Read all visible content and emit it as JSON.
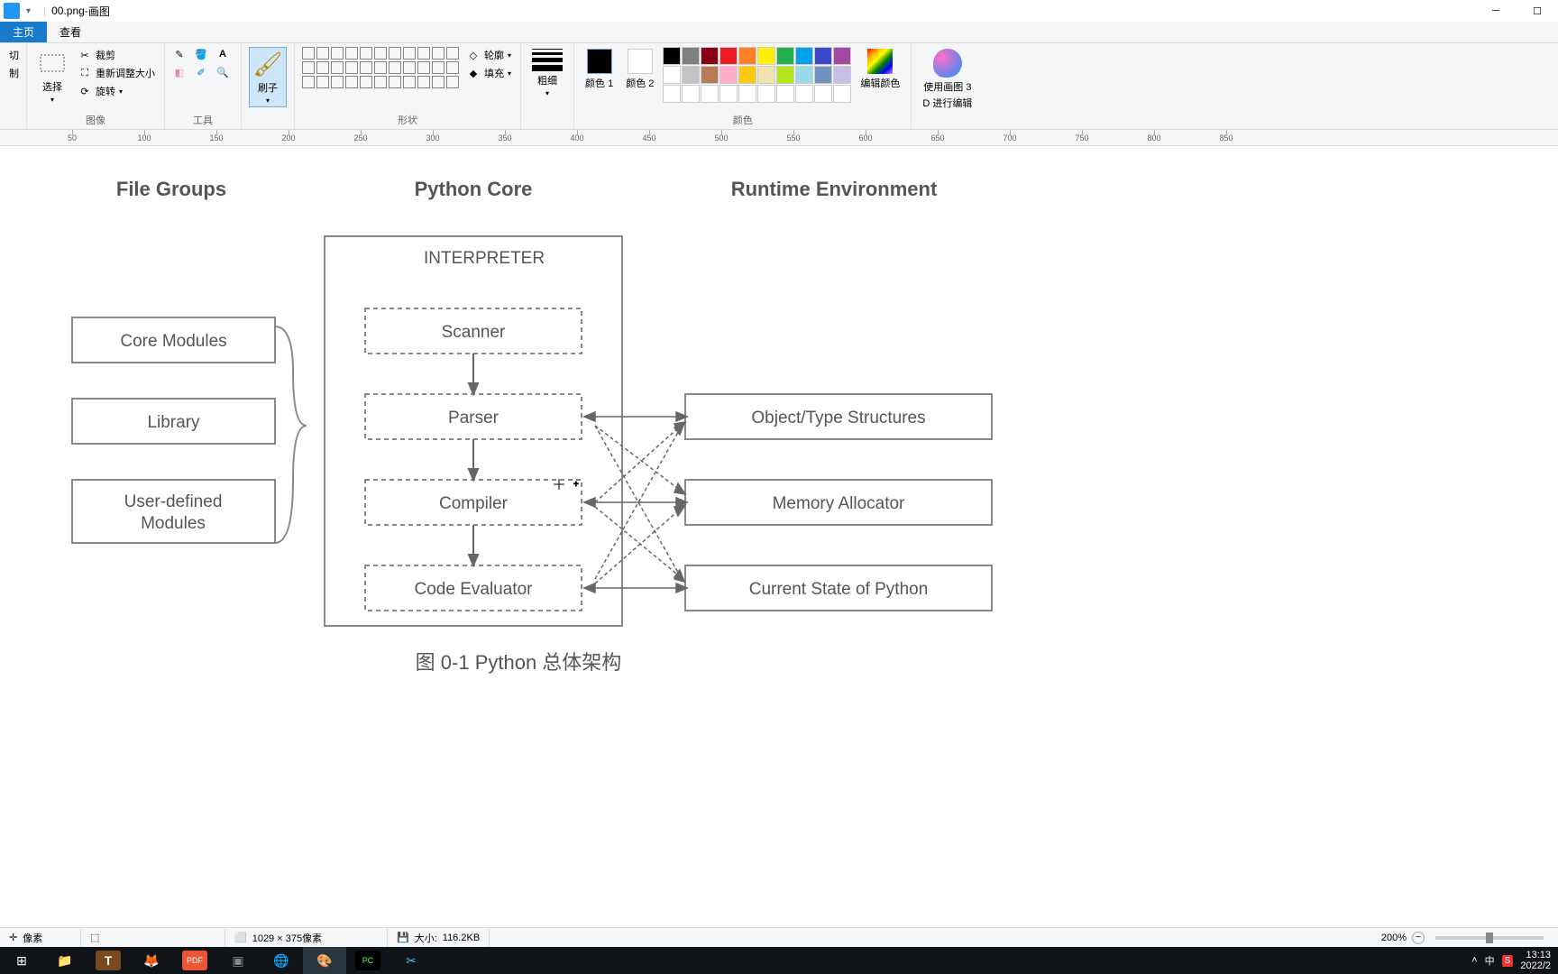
{
  "window": {
    "filename": "00.png",
    "app_name": "画图",
    "title_sep": " - "
  },
  "tabs": {
    "file": "主页",
    "view": "查看"
  },
  "ribbon": {
    "clipboard": {
      "cut": "切",
      "control_label": "制",
      "group": ""
    },
    "image": {
      "select": "选择",
      "crop": "裁剪",
      "resize": "重新调整大小",
      "rotate": "旋转",
      "group": "图像"
    },
    "tools": {
      "group": "工具"
    },
    "brushes": {
      "label": "刷子",
      "group": ""
    },
    "shapes": {
      "outline": "轮廓",
      "fill": "填充",
      "group": "形状"
    },
    "size": {
      "label": "粗细",
      "group": ""
    },
    "colors": {
      "color1": "颜色 1",
      "color2": "颜色 2",
      "edit": "编辑颜色",
      "group": "颜色"
    },
    "paint3d": {
      "line1": "使用画图 3",
      "line2": "D 进行编辑"
    }
  },
  "ruler_marks": [
    50,
    100,
    150,
    200,
    250,
    300,
    350,
    400,
    450,
    500,
    550,
    600,
    650,
    700,
    750,
    800,
    850
  ],
  "diagram": {
    "headers": {
      "left": "File Groups",
      "mid": "Python Core",
      "right": "Runtime Environment"
    },
    "interpreter_label": "INTERPRETER",
    "left_boxes": [
      "Core Modules",
      "Library",
      "User-defined Modules"
    ],
    "mid_boxes": [
      "Scanner",
      "Parser",
      "Compiler",
      "Code Evaluator"
    ],
    "right_boxes": [
      "Object/Type Structures",
      "Memory Allocator",
      "Current State of Python"
    ],
    "caption": "图 0-1   Python 总体架构"
  },
  "status": {
    "pixels_label": "像素",
    "dimensions": "1029 × 375像素",
    "size_label": "大小:",
    "size_value": "116.2KB",
    "zoom": "200%"
  },
  "tray": {
    "ime": "中",
    "time": "13:13",
    "date": "2022/2"
  },
  "palette": [
    "#000000",
    "#7f7f7f",
    "#880015",
    "#ed1c24",
    "#ff7f27",
    "#fff200",
    "#22b14c",
    "#00a2e8",
    "#3f48cc",
    "#a349a4",
    "#ffffff",
    "#c3c3c3",
    "#b97a57",
    "#ffaec9",
    "#ffc90e",
    "#efe4b0",
    "#b5e61d",
    "#99d9ea",
    "#7092be",
    "#c8bfe7",
    "#ffffff",
    "#ffffff",
    "#ffffff",
    "#ffffff",
    "#ffffff",
    "#ffffff",
    "#ffffff",
    "#ffffff",
    "#ffffff",
    "#ffffff"
  ]
}
